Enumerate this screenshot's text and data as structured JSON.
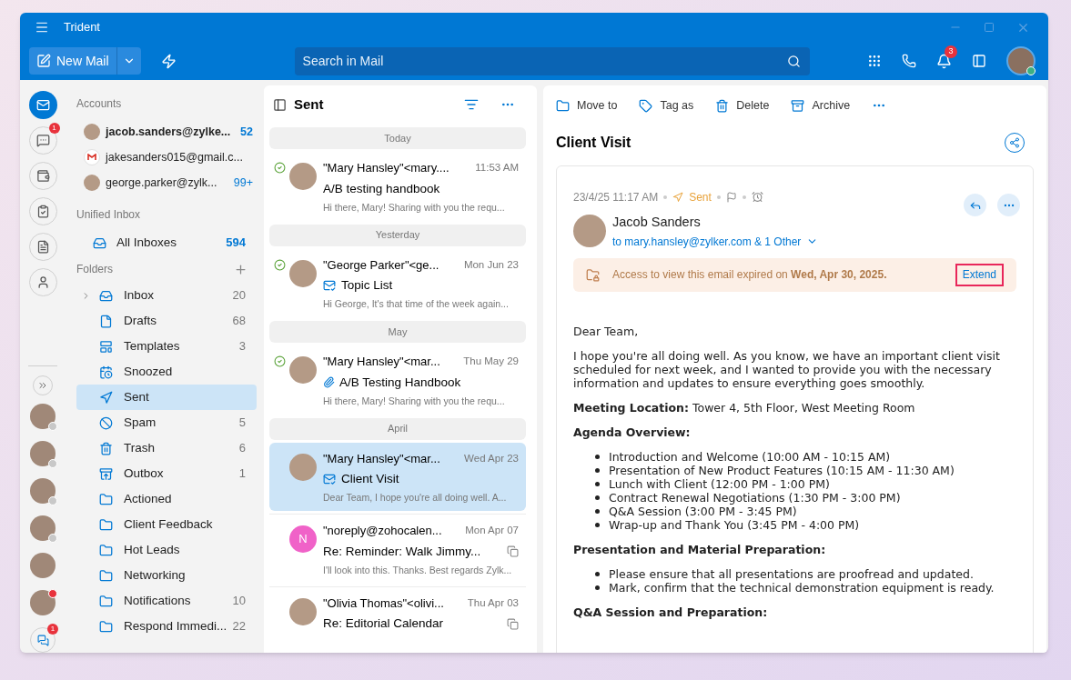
{
  "window": {
    "title": "Trident"
  },
  "toolbar": {
    "new_mail": "New Mail",
    "search_placeholder": "Search in Mail",
    "notification_badge": "3"
  },
  "rail": {
    "items": [
      {
        "kind": "mail",
        "selected": true
      },
      {
        "kind": "chat",
        "selected": false,
        "badge": "1"
      },
      {
        "kind": "wallet",
        "selected": false
      },
      {
        "kind": "tasks",
        "selected": false
      },
      {
        "kind": "notes",
        "selected": false
      },
      {
        "kind": "contacts",
        "selected": false
      }
    ],
    "contacts": [
      {
        "kind": "photo",
        "color": "#c8c8c8"
      },
      {
        "kind": "photo",
        "color": "#c8c8c8"
      },
      {
        "kind": "photo",
        "color": "#c8c8c8"
      },
      {
        "kind": "photo",
        "color": "#c8c8c8"
      },
      {
        "kind": "photo"
      },
      {
        "kind": "photo",
        "color": "#e8323c"
      }
    ],
    "chat_badge": "1"
  },
  "accounts": {
    "heading": "Accounts",
    "items": [
      {
        "email": "jacob.sanders@zylke...",
        "count": "52",
        "selected": true,
        "kind": "photo"
      },
      {
        "email": "jakesanders015@gmail.c...",
        "selected": false,
        "kind": "gmail"
      },
      {
        "email": "george.parker@zylk...",
        "count": "99+",
        "selected": false,
        "kind": "photo"
      }
    ]
  },
  "unified": {
    "heading": "Unified Inbox",
    "items": [
      {
        "label": "All Inboxes",
        "count": "594"
      }
    ]
  },
  "folders": {
    "heading": "Folders",
    "items": [
      {
        "name": "Inbox",
        "count": "20",
        "kind": "inbox",
        "expandable": true,
        "selected": false
      },
      {
        "name": "Drafts",
        "count": "68",
        "kind": "drafts",
        "expandable": false,
        "selected": false
      },
      {
        "name": "Templates",
        "count": "3",
        "kind": "templates",
        "expandable": false,
        "selected": false
      },
      {
        "name": "Snoozed",
        "kind": "snoozed",
        "expandable": false,
        "selected": false
      },
      {
        "name": "Sent",
        "kind": "sent",
        "expandable": false,
        "selected": true
      },
      {
        "name": "Spam",
        "count": "5",
        "kind": "spam",
        "expandable": false,
        "selected": false
      },
      {
        "name": "Trash",
        "count": "6",
        "kind": "trash",
        "expandable": false,
        "selected": false
      },
      {
        "name": "Outbox",
        "count": "1",
        "kind": "outbox",
        "expandable": false,
        "selected": false
      },
      {
        "name": "Actioned",
        "kind": "custom",
        "expandable": false,
        "selected": false
      },
      {
        "name": "Client Feedback",
        "kind": "custom",
        "expandable": false,
        "selected": false
      },
      {
        "name": "Hot Leads",
        "kind": "custom",
        "expandable": false,
        "selected": false
      },
      {
        "name": "Networking",
        "kind": "custom",
        "expandable": false,
        "selected": false
      },
      {
        "name": "Notifications",
        "count": "10",
        "kind": "custom",
        "expandable": false,
        "selected": false
      },
      {
        "name": "Respond Immedi...",
        "count": "22",
        "kind": "custom",
        "expandable": false,
        "selected": false
      }
    ]
  },
  "message_list": {
    "title": "Sent",
    "groups": [
      {
        "label": "Today",
        "messages": [
          {
            "sender": "\"Mary Hansley\"<mary....",
            "time": "11:53 AM",
            "subject": "A/B testing handbook",
            "preview": "Hi there, Mary! Sharing with you the requ...",
            "delivered": true,
            "thread": false,
            "selected": false
          }
        ]
      },
      {
        "label": "Yesterday",
        "messages": [
          {
            "sender": "\"George Parker\"<ge...",
            "time": "Mon Jun 23",
            "subject": "Topic List",
            "preview": "Hi George, It's that time of the week again...",
            "delivered": true,
            "kind": "secure",
            "thread": false,
            "selected": false
          }
        ]
      },
      {
        "label": "May",
        "messages": [
          {
            "sender": "\"Mary Hansley\"<mar...",
            "time": "Thu May 29",
            "subject": "A/B Testing Handbook",
            "preview": "Hi there, Mary! Sharing with you the requ...",
            "delivered": true,
            "kind": "attachment",
            "thread": false,
            "selected": false
          }
        ]
      },
      {
        "label": "April",
        "messages": [
          {
            "sender": "\"Mary Hansley\"<mar...",
            "time": "Wed Apr 23",
            "subject": "Client Visit",
            "preview": "Dear Team, I hope you're all doing well. A...",
            "delivered": false,
            "kind": "secure",
            "thread": false,
            "selected": true
          },
          {
            "sender": "\"noreply@zohocalen...",
            "time": "Mon Apr 07",
            "subject": "Re: Reminder: Walk Jimmy...",
            "preview": "I'll look into this. Thanks. Best regards Zylk...",
            "delivered": false,
            "letter": "N",
            "thread": true,
            "selected": false
          },
          {
            "sender": "\"Olivia Thomas\"<olivi...",
            "time": "Thu Apr 03",
            "subject": "Re: Editorial Calendar",
            "delivered": false,
            "thread": true,
            "selected": false
          }
        ]
      }
    ]
  },
  "reader": {
    "actions": [
      "Move to",
      "Tag as",
      "Delete",
      "Archive"
    ],
    "subject": "Client Visit",
    "date": "23/4/25 11:17 AM",
    "status": "Sent",
    "sender": "Jacob Sanders",
    "recipients": "to mary.hansley@zylker.com & 1 Other",
    "notice": "Access to view this email expired on **Wed, Apr 30, 2025.**",
    "notice_action": "Extend",
    "body": [
      {
        "kind": "paragraph",
        "text": "Dear Team,"
      },
      {
        "kind": "paragraph",
        "text": "I hope you're all doing well. As you know, we have an important client visit scheduled for next week, and I wanted to provide you with the necessary information and updates to ensure everything goes smoothly."
      },
      {
        "kind": "paragraph",
        "text": "**Meeting Location:** Tower 4, 5th Floor, West Meeting Room"
      },
      {
        "kind": "heading",
        "text": "Agenda Overview:"
      },
      {
        "kind": "list",
        "items": [
          "Introduction and Welcome (10:00 AM - 10:15 AM)",
          "Presentation of New Product Features (10:15 AM - 11:30 AM)",
          "Lunch with Client (12:00 PM - 1:00 PM)",
          "Contract Renewal Negotiations (1:30 PM - 3:00 PM)",
          "Q&A Session (3:00 PM - 3:45 PM)",
          "Wrap-up and Thank You (3:45 PM - 4:00 PM)"
        ]
      },
      {
        "kind": "heading",
        "text": "Presentation and Material Preparation:"
      },
      {
        "kind": "list",
        "items": [
          "Please ensure that all presentations are proofread and updated.",
          "Mark, confirm that the technical demonstration equipment is ready."
        ]
      },
      {
        "kind": "heading",
        "text": "Q&A Session and Preparation:"
      }
    ]
  }
}
